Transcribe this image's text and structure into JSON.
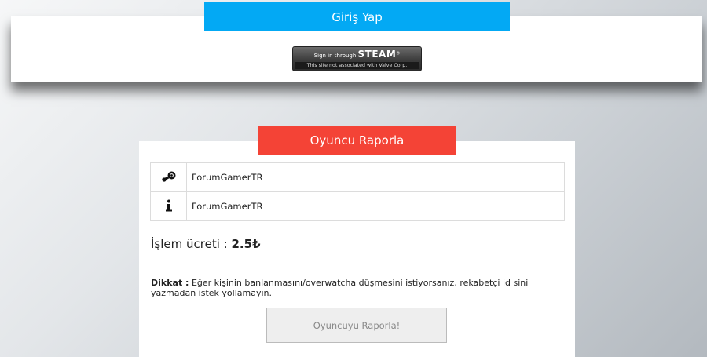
{
  "login": {
    "header": "Giriş Yap",
    "steam_button": {
      "line1_prefix": "Sign in through",
      "line1_brand": "STEAM",
      "line2": "This site not associated with Valve Corp."
    }
  },
  "report": {
    "header": "Oyuncu Raporla",
    "rows": [
      {
        "icon": "steam-icon",
        "value": "ForumGamerTR"
      },
      {
        "icon": "info-icon",
        "value": "ForumGamerTR"
      }
    ],
    "fee_label": "İşlem ücreti :",
    "fee_value": "2.5₺",
    "warning_label": "Dikkat :",
    "warning_text": "Eğer kişinin banlanmasını/overwatcha düşmesini istiyorsanız, rekabetçi id sini yazmadan istek yollamayın.",
    "submit_label": "Oyuncuyu Raporla!"
  },
  "colors": {
    "login_accent": "#03a9f4",
    "report_accent": "#f44336"
  }
}
